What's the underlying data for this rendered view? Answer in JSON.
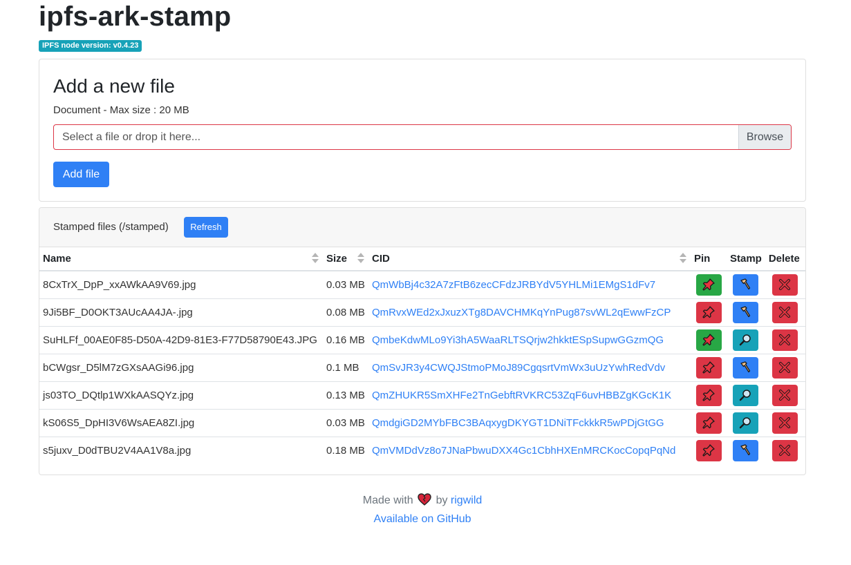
{
  "header": {
    "title": "ipfs-ark-stamp",
    "version_badge": "IPFS node version: v0.4.23"
  },
  "upload": {
    "title": "Add a new file",
    "hint": "Document - Max size : 20 MB",
    "placeholder": "Select a file or drop it here...",
    "browse_label": "Browse",
    "add_label": "Add file"
  },
  "files": {
    "header_title": "Stamped files (/stamped)",
    "refresh_label": "Refresh",
    "columns": [
      "Name",
      "Size",
      "CID",
      "Pin",
      "Stamp",
      "Delete"
    ],
    "rows": [
      {
        "name": "8CxTrX_DpP_xxAWkAA9V69.jpg",
        "size": "0.03 MB",
        "cid": "QmWbBj4c32A7zFtB6zecCFdzJRBYdV5YHLMi1EMgS1dFv7",
        "pinned": true,
        "stamp": "hammer"
      },
      {
        "name": "9Ji5BF_D0OKT3AUcAA4JA-.jpg",
        "size": "0.08 MB",
        "cid": "QmRvxWEd2xJxuzXTg8DAVCHMKqYnPug87svWL2qEwwFzCP",
        "pinned": false,
        "stamp": "hammer"
      },
      {
        "name": "SuHLFf_00AE0F85-D50A-42D9-81E3-F77D58790E43.JPG",
        "size": "0.16 MB",
        "cid": "QmbeKdwMLo9Yi3hA5WaaRLTSQrjw2hkktESpSupwGGzmQG",
        "pinned": true,
        "stamp": "search"
      },
      {
        "name": "bCWgsr_D5lM7zGXsAAGi96.jpg",
        "size": "0.1 MB",
        "cid": "QmSvJR3y4CWQJStmoPMoJ89CgqsrtVmWx3uUzYwhRedVdv",
        "pinned": false,
        "stamp": "hammer"
      },
      {
        "name": "js03TO_DQtlp1WXkAASQYz.jpg",
        "size": "0.13 MB",
        "cid": "QmZHUKR5SmXHFe2TnGebftRVKRC53ZqF6uvHBBZgKGcK1K",
        "pinned": false,
        "stamp": "search"
      },
      {
        "name": "kS06S5_DpHI3V6WsAEA8ZI.jpg",
        "size": "0.03 MB",
        "cid": "QmdgiGD2MYbFBC3BAqxygDKYGT1DNiTFckkkR5wPDjGtGG",
        "pinned": false,
        "stamp": "search"
      },
      {
        "name": "s5juxv_D0dTBU2V4AA1V8a.jpg",
        "size": "0.18 MB",
        "cid": "QmVMDdVz8o7JNaPbwuDXX4Gc1CbhHXEnMRCKocCopqPqNd",
        "pinned": false,
        "stamp": "hammer"
      }
    ]
  },
  "footer": {
    "made_with": "Made with",
    "by": "by",
    "author": "rigwild",
    "github": "Available on GitHub"
  },
  "colors": {
    "primary": "#2f80f5",
    "danger": "#dc3545",
    "success": "#28a745",
    "info": "#17a2b8"
  },
  "icons": {
    "pin": "pushpin-icon",
    "stamp": "hammer-icon",
    "verify": "magnifier-icon",
    "delete": "x-icon",
    "heart": "heart-icon"
  }
}
